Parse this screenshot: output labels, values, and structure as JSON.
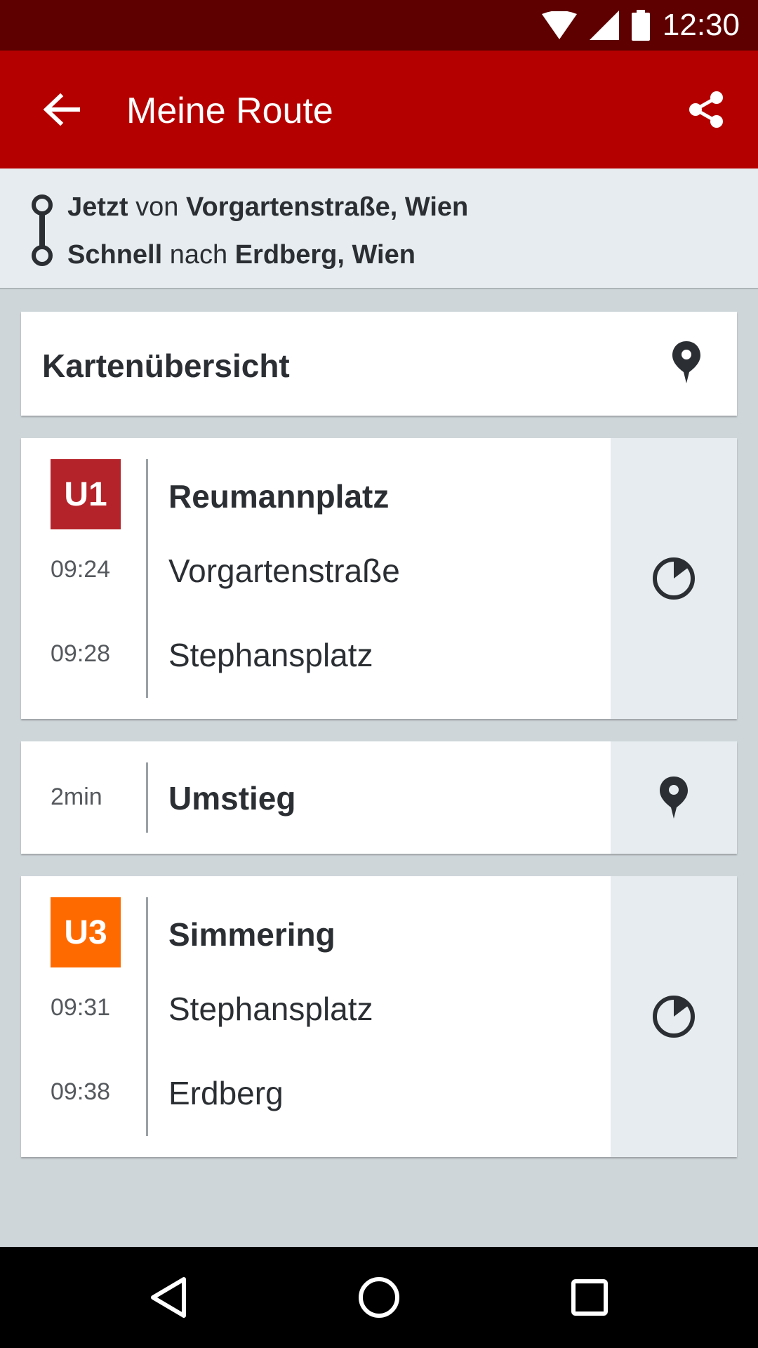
{
  "status_bar": {
    "time": "12:30",
    "icons": [
      "wifi-icon",
      "signal-icon",
      "battery-icon"
    ]
  },
  "app_bar": {
    "title": "Meine Route",
    "back_icon": "arrow-back-icon",
    "share_icon": "share-icon"
  },
  "route": {
    "line1": {
      "when": "Jetzt",
      "connector": "von",
      "place": "Vorgartenstraße, Wien"
    },
    "line2": {
      "mode": "Schnell",
      "connector": "nach",
      "place": "Erdberg, Wien"
    }
  },
  "map_overview": {
    "label": "Kartenübersicht",
    "icon": "map-pin-icon"
  },
  "legs": [
    {
      "line": "U1",
      "color": "#b5232a",
      "direction": "Reumannplatz",
      "stops": [
        {
          "time": "09:24",
          "name": "Vorgartenstraße"
        },
        {
          "time": "09:28",
          "name": "Stephansplatz"
        }
      ],
      "side_icon": "departure-clock-icon"
    },
    {
      "line": "U3",
      "color": "#ff6a00",
      "direction": "Simmering",
      "stops": [
        {
          "time": "09:31",
          "name": "Stephansplatz"
        },
        {
          "time": "09:38",
          "name": "Erdberg"
        }
      ],
      "side_icon": "departure-clock-icon"
    }
  ],
  "transfer": {
    "duration": "2min",
    "label": "Umstieg",
    "icon": "map-pin-icon"
  },
  "colors": {
    "app_bar": "#b50000",
    "status_bar": "#5f0000",
    "background": "#cfd6da",
    "panel": "#e6ecef"
  },
  "nav_bar": {
    "icons": [
      "nav-back-icon",
      "nav-home-icon",
      "nav-recents-icon"
    ]
  }
}
